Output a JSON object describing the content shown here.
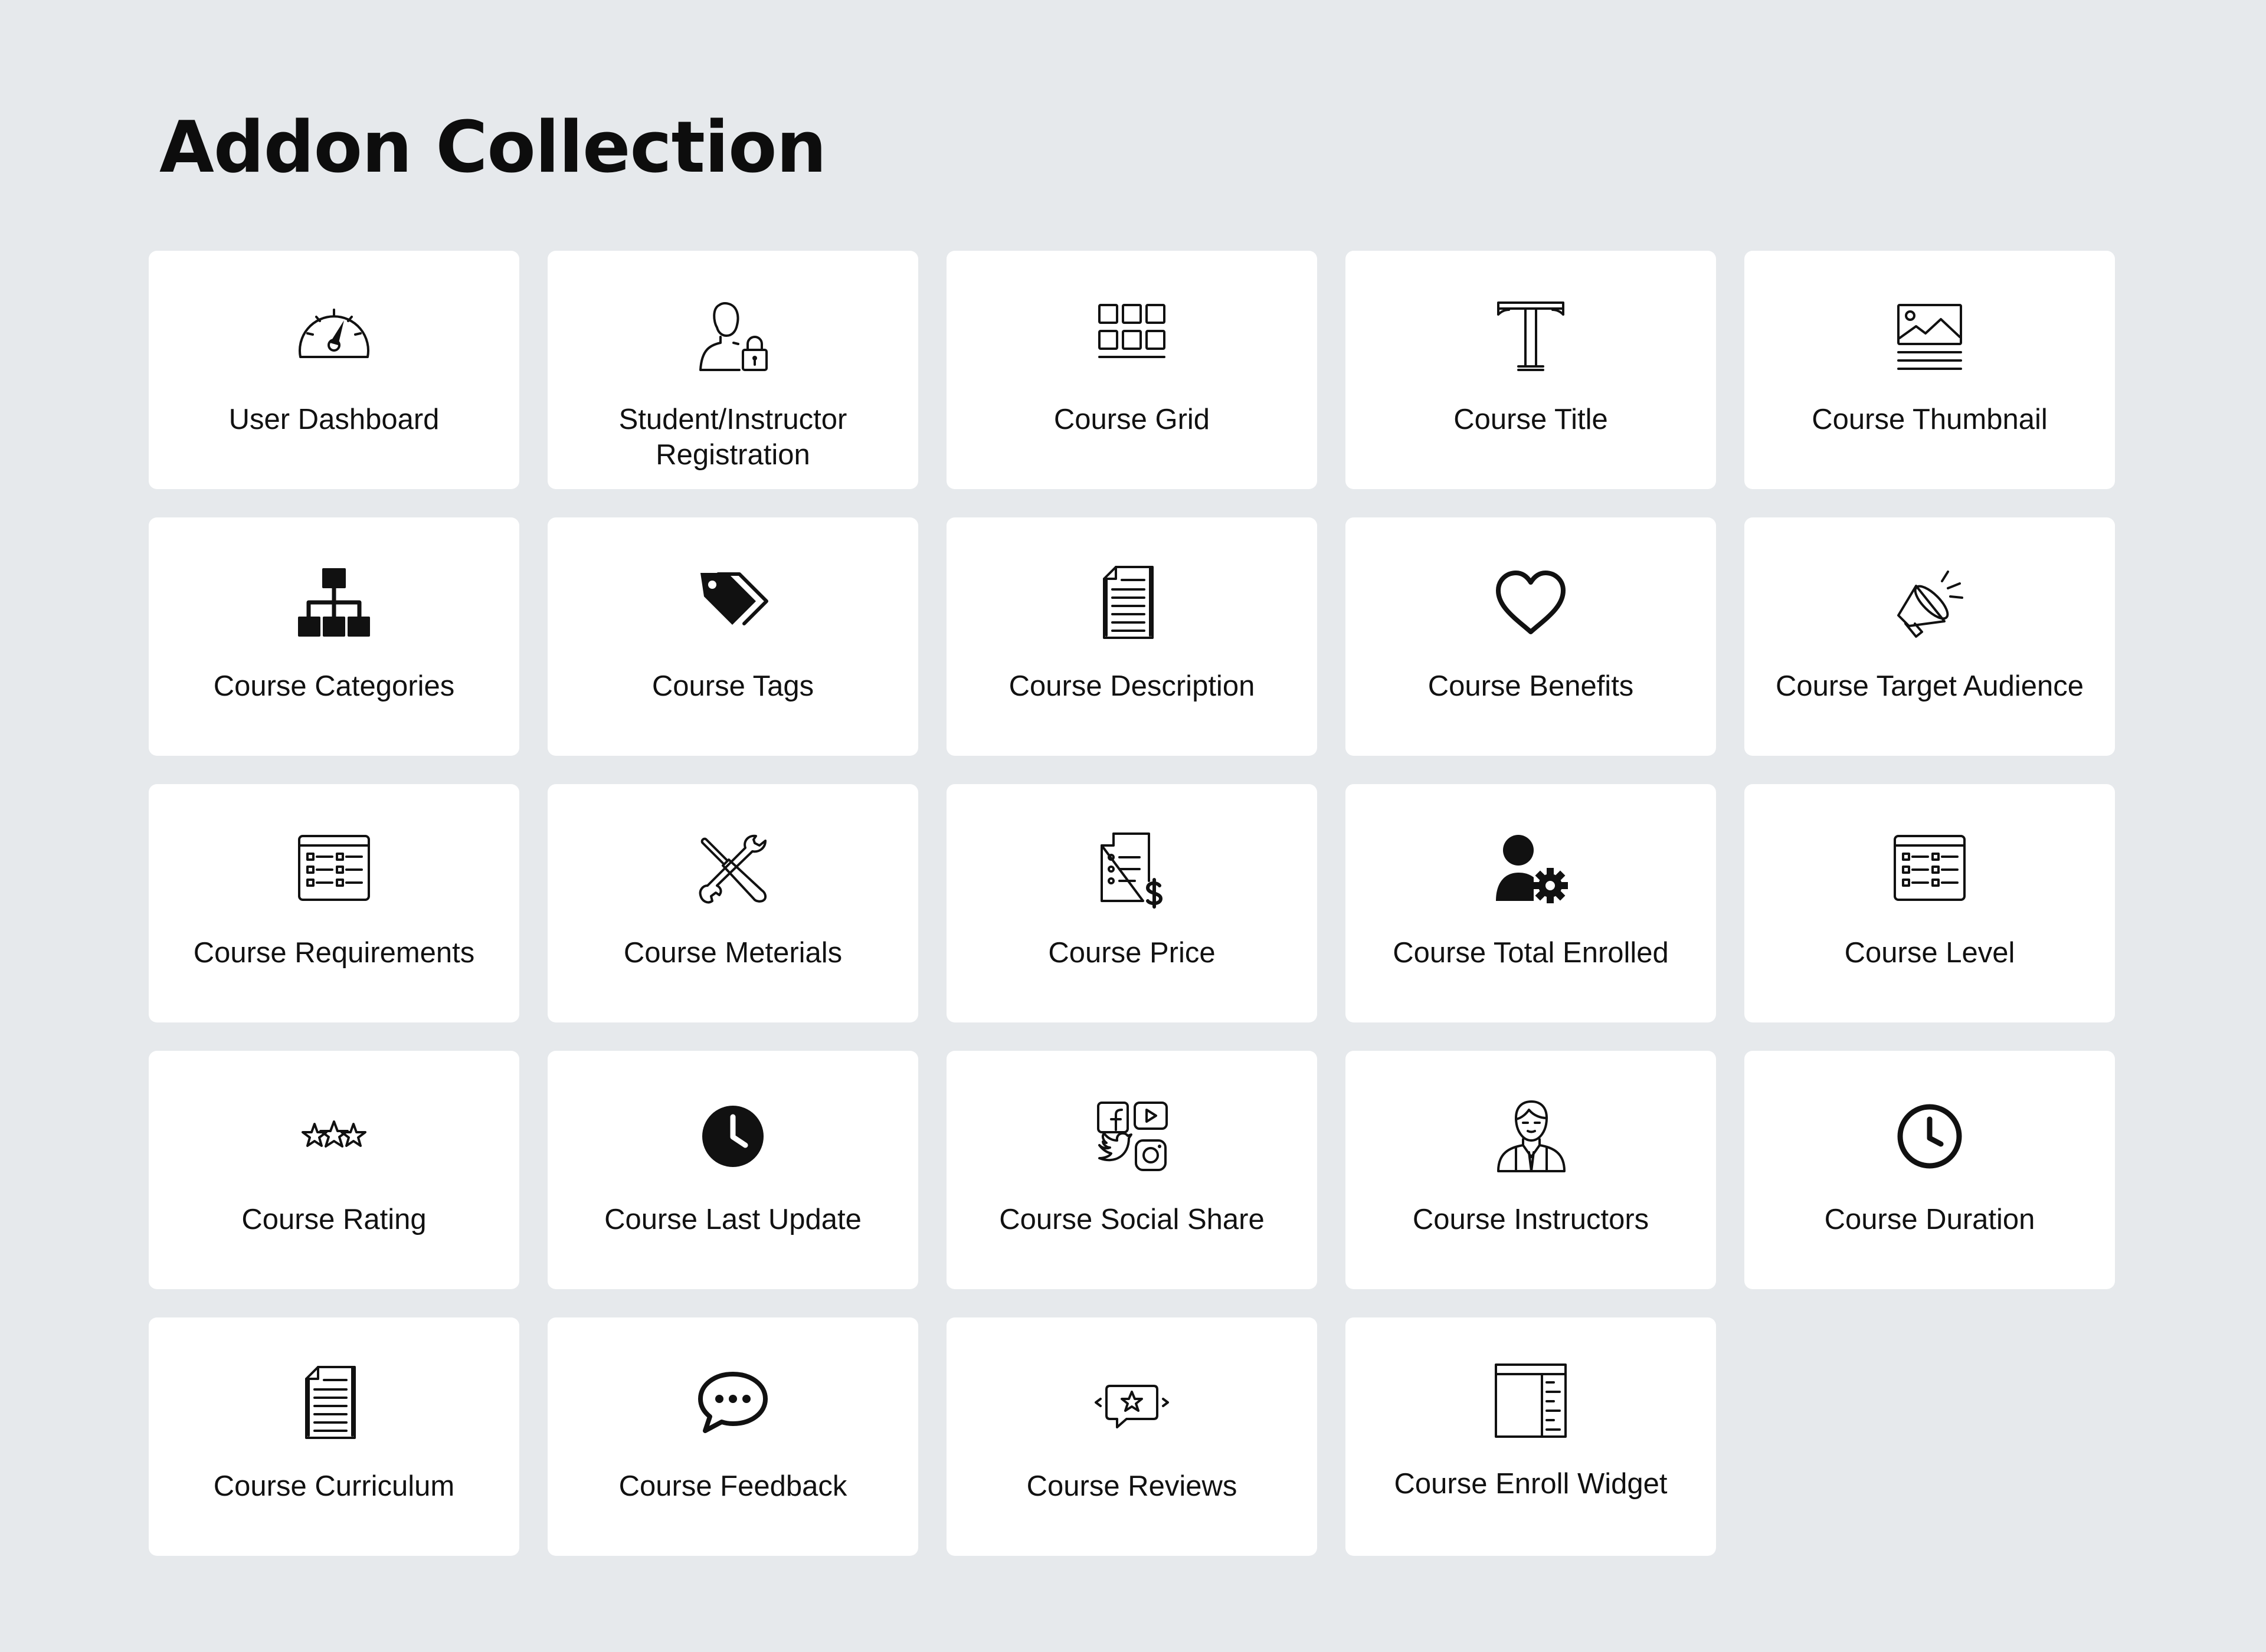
{
  "page": {
    "title": "Addon Collection",
    "background_color": "#e6e9ec",
    "card_color": "#ffffff"
  },
  "addons": [
    {
      "label": "User Dashboard",
      "icon": "speedometer-icon"
    },
    {
      "label": "Student/Instructor Registration",
      "icon": "user-lock-icon"
    },
    {
      "label": "Course Grid",
      "icon": "grid-icon"
    },
    {
      "label": "Course Title",
      "icon": "title-t-icon"
    },
    {
      "label": "Course Thumbnail",
      "icon": "image-icon"
    },
    {
      "label": "Course Categories",
      "icon": "hierarchy-icon"
    },
    {
      "label": "Course Tags",
      "icon": "tags-icon"
    },
    {
      "label": "Course Description",
      "icon": "document-icon"
    },
    {
      "label": "Course Benefits",
      "icon": "heart-icon"
    },
    {
      "label": "Course Target Audience",
      "icon": "megaphone-icon"
    },
    {
      "label": "Course Requirements",
      "icon": "checklist-panel-icon"
    },
    {
      "label": "Course Meterials",
      "icon": "tools-icon"
    },
    {
      "label": "Course Price",
      "icon": "invoice-dollar-icon"
    },
    {
      "label": "Course Total Enrolled",
      "icon": "user-gear-icon"
    },
    {
      "label": "Course Level",
      "icon": "list-panel-icon"
    },
    {
      "label": "Course Rating",
      "icon": "stars-icon"
    },
    {
      "label": "Course Last Update",
      "icon": "clock-solid-icon"
    },
    {
      "label": "Course Social Share",
      "icon": "social-icons-icon"
    },
    {
      "label": "Course Instructors",
      "icon": "instructor-icon"
    },
    {
      "label": "Course Duration",
      "icon": "clock-outline-icon"
    },
    {
      "label": "Course Curriculum",
      "icon": "curriculum-doc-icon"
    },
    {
      "label": "Course Feedback",
      "icon": "chat-bubble-icon"
    },
    {
      "label": "Course Reviews",
      "icon": "review-star-icon"
    },
    {
      "label": "Course Enroll Widget",
      "icon": "layout-widget-icon"
    }
  ]
}
